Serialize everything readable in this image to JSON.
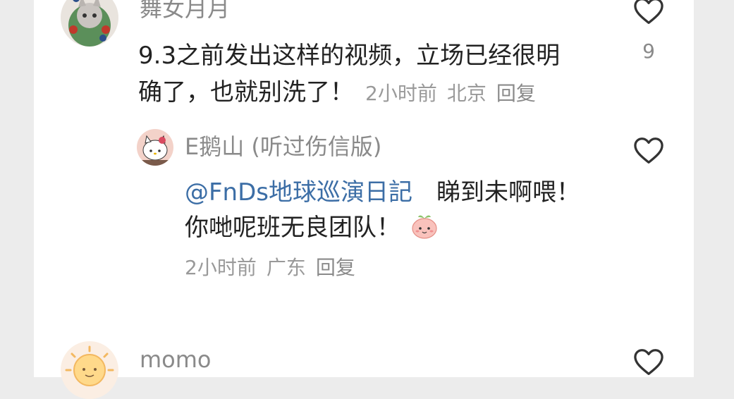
{
  "comments": [
    {
      "username": "舞女月月",
      "line1": "9.3之前发出这样的视频，立场已经很明",
      "line2": "确了，也就别洗了！",
      "time": "2小时前",
      "location": "北京",
      "reply_label": "回复",
      "like_count": "9",
      "icons": [
        "avatar-cat",
        "heart-outline-icon"
      ]
    },
    {
      "username": "E鹅山 (听过伤信版)",
      "mention": "@FnDs地球巡演日記",
      "line1_rest": "睇到未啊喂！",
      "line2": "你哋呢班无良团队！",
      "emoji": "peach-face-emoji",
      "time": "2小时前",
      "location": "广东",
      "reply_label": "回复"
    },
    {
      "username": "momo"
    }
  ],
  "colors": {
    "username": "#8a8a8a",
    "text": "#222222",
    "meta": "#9a9a9a",
    "mention": "#3c6ea6"
  }
}
